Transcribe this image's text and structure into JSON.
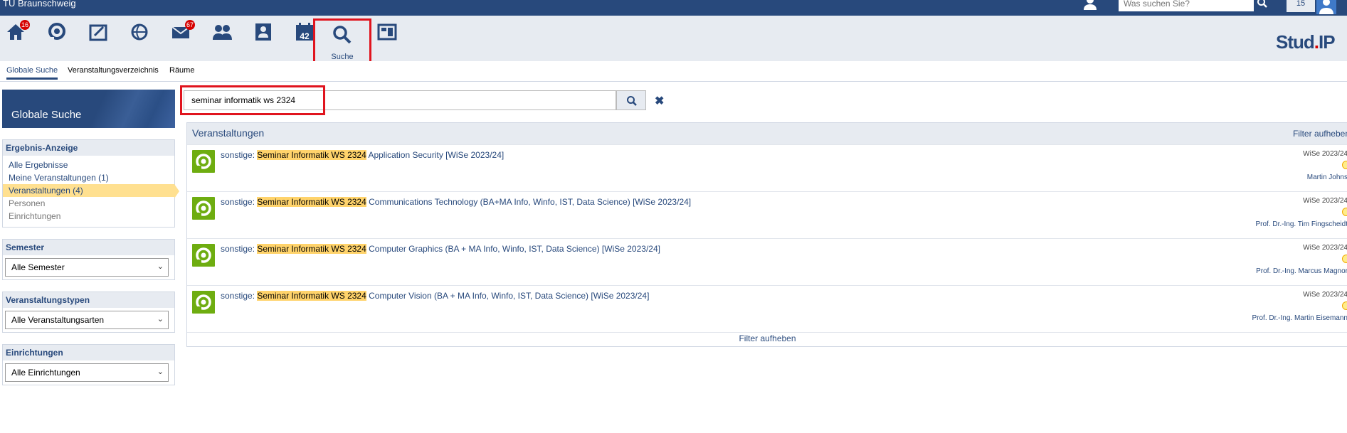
{
  "topbar": {
    "brand": "TU Braunschweig",
    "search_placeholder": "Was suchen Sie?",
    "counter": "15"
  },
  "nav": {
    "home_badge": "16",
    "messages_badge": "67",
    "calendar_day": "42",
    "search_label": "Suche",
    "logo_left": "Stud",
    "logo_dot": ".",
    "logo_right": "IP"
  },
  "subnav": [
    "Globale Suche",
    "Veranstaltungsverzeichnis",
    "Räume"
  ],
  "sidebar": {
    "title": "Globale Suche",
    "results_widget_title": "Ergebnis-Anzeige",
    "result_links": [
      "Alle Ergebnisse",
      "Meine Veranstaltungen (1)",
      "Veranstaltungen (4)",
      "Personen",
      "Einrichtungen"
    ],
    "semester_title": "Semester",
    "semester_value": "Alle Semester",
    "types_title": "Veranstaltungstypen",
    "types_value": "Alle Veranstaltungsarten",
    "inst_title": "Einrichtungen",
    "inst_value": "Alle Einrichtungen"
  },
  "search": {
    "query": "seminar informatik ws 2324"
  },
  "results": {
    "heading": "Veranstaltungen",
    "filter_reset": "Filter aufheben",
    "footer": "Filter aufheben",
    "items": [
      {
        "prefix": "sonstige:",
        "match": "Seminar Informatik WS 2324",
        "rest": "Application Security [WiSe 2023/24]",
        "semester": "WiSe 2023/24",
        "lecturer": "Martin Johns"
      },
      {
        "prefix": "sonstige:",
        "match": "Seminar Informatik WS 2324",
        "rest": "Communications Technology (BA+MA Info, Winfo, IST, Data Science) [WiSe 2023/24]",
        "semester": "WiSe 2023/24",
        "lecturer": "Prof. Dr.-Ing. Tim Fingscheidt"
      },
      {
        "prefix": "sonstige:",
        "match": "Seminar Informatik WS 2324",
        "rest": "Computer Graphics (BA + MA Info, Winfo, IST, Data Science) [WiSe 2023/24]",
        "semester": "WiSe 2023/24",
        "lecturer": "Prof. Dr.-Ing. Marcus Magnor"
      },
      {
        "prefix": "sonstige:",
        "match": "Seminar Informatik WS 2324",
        "rest": "Computer Vision (BA + MA Info, Winfo, IST, Data Science) [WiSe 2023/24]",
        "semester": "WiSe 2023/24",
        "lecturer": "Prof. Dr.-Ing. Martin Eisemann"
      }
    ]
  }
}
